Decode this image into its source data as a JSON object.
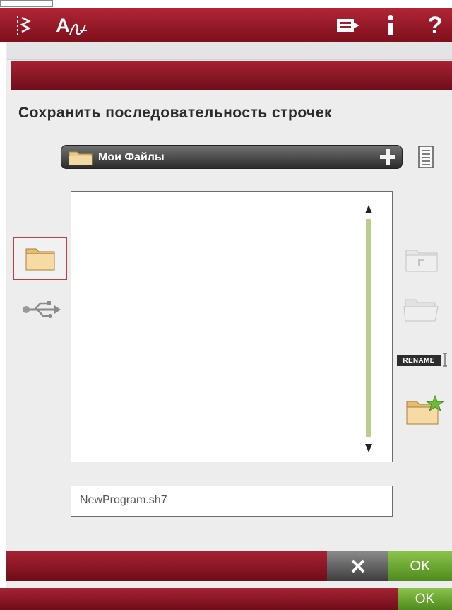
{
  "colors": {
    "accent_red": "#a52233",
    "ok_green": "#6aa832",
    "scroll_green": "#b8cd8e"
  },
  "topbar": {
    "icons": [
      "stitch-menu-icon",
      "font-menu-icon",
      "file-manager-icon",
      "info-icon",
      "help-icon"
    ],
    "font_icon_text": "A",
    "help_text": "?"
  },
  "dialog": {
    "title": "Сохранить последовательность строчек",
    "path_label": "Мои Файлы",
    "filename": "NewProgram.sh7",
    "rename_label": "RENAME",
    "ok_label": "OK"
  },
  "footer": {
    "ok_label": "OK"
  }
}
